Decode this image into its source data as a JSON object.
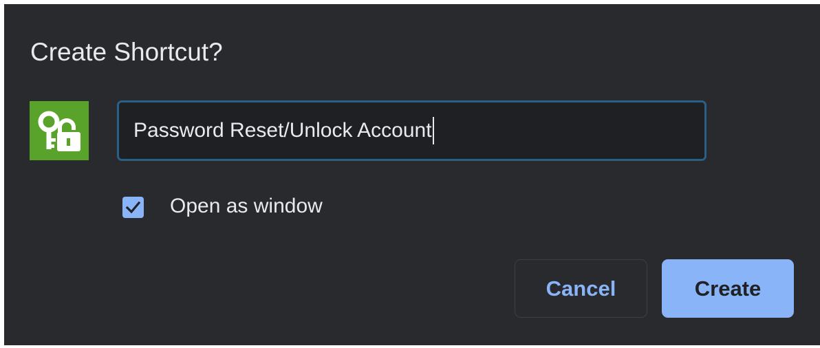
{
  "dialog": {
    "title": "Create Shortcut?",
    "app_icon": "keys-padlock-icon",
    "name_input": {
      "value": "Password Reset/Unlock Account"
    },
    "open_as_window": {
      "label": "Open as window",
      "checked": true
    },
    "buttons": {
      "cancel": "Cancel",
      "create": "Create"
    }
  },
  "colors": {
    "background": "#292a2d",
    "text": "#e8eaed",
    "accent": "#8ab4f8",
    "icon_green": "#5aa32a",
    "input_border": "#2a5f86"
  }
}
